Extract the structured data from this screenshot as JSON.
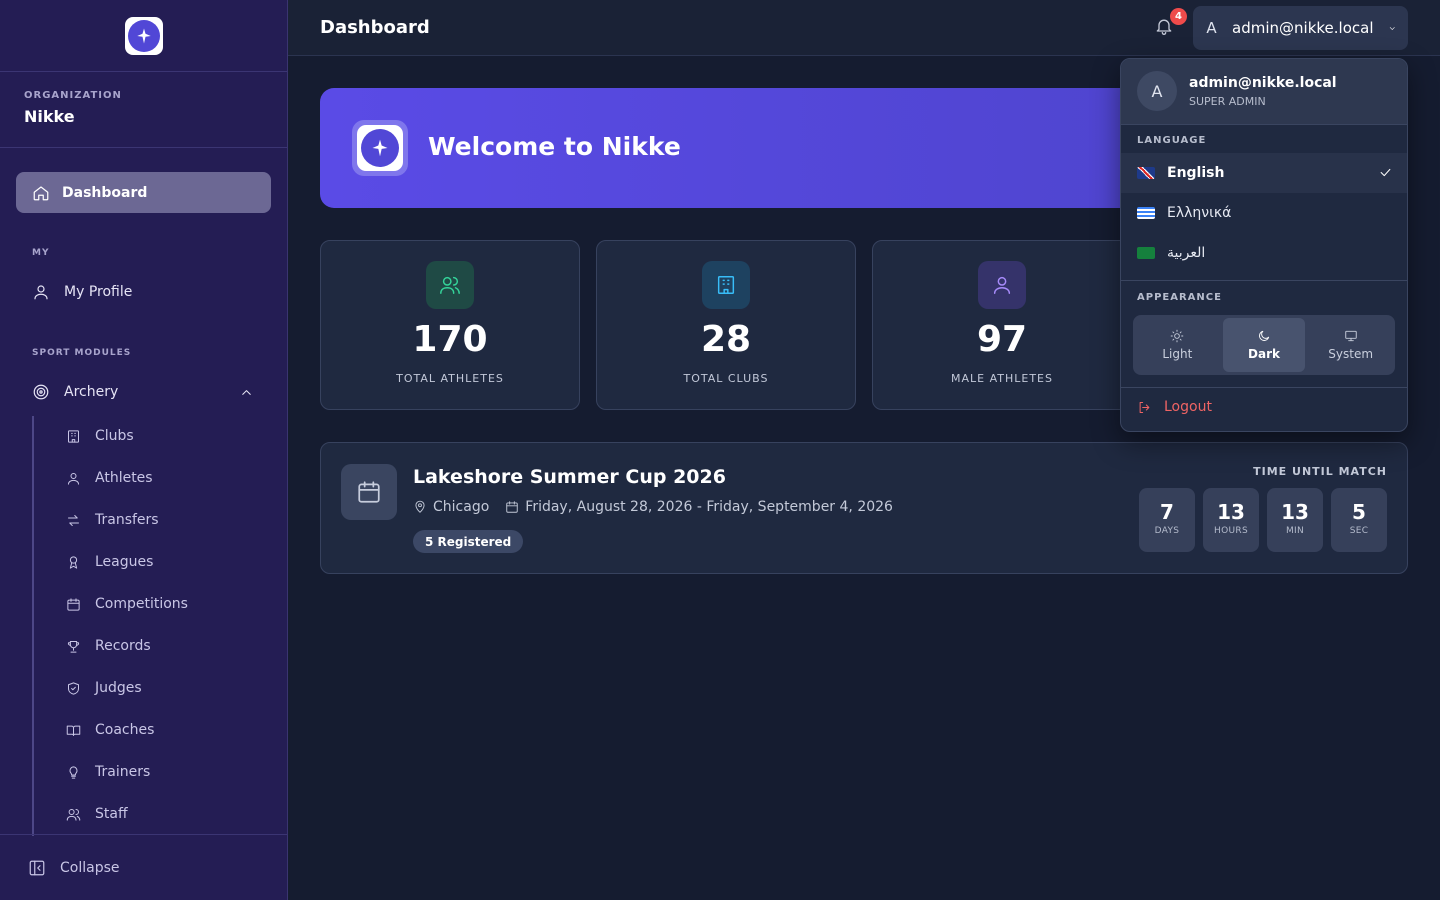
{
  "sidebar": {
    "org_label": "ORGANIZATION",
    "org_name": "Nikke",
    "active_item": "Dashboard",
    "section_my": "MY",
    "my_profile": "My Profile",
    "section_sport": "SPORT MODULES",
    "sport": "Archery",
    "sub_items": [
      {
        "label": "Clubs",
        "icon": "building-icon"
      },
      {
        "label": "Athletes",
        "icon": "user-icon"
      },
      {
        "label": "Transfers",
        "icon": "transfer-icon"
      },
      {
        "label": "Leagues",
        "icon": "award-icon"
      },
      {
        "label": "Competitions",
        "icon": "calendar-icon"
      },
      {
        "label": "Records",
        "icon": "trophy-icon"
      },
      {
        "label": "Judges",
        "icon": "shield-icon"
      },
      {
        "label": "Coaches",
        "icon": "book-icon"
      },
      {
        "label": "Trainers",
        "icon": "lightbulb-icon"
      },
      {
        "label": "Staff",
        "icon": "users-icon"
      }
    ],
    "collapse": "Collapse"
  },
  "header": {
    "title": "Dashboard",
    "notifications": "4",
    "user_initial": "A",
    "user_email": "admin@nikke.local"
  },
  "banner": {
    "title": "Welcome to Nikke"
  },
  "stats": [
    {
      "value": "170",
      "label": "TOTAL ATHLETES",
      "color": "#34d399"
    },
    {
      "value": "28",
      "label": "TOTAL CLUBS",
      "color": "#38bdf8"
    },
    {
      "value": "97",
      "label": "MALE ATHLETES",
      "color": "#a78bfa"
    }
  ],
  "event": {
    "title": "Lakeshore Summer Cup 2026",
    "location": "Chicago",
    "dates": "Friday, August 28, 2026 - Friday, September 4, 2026",
    "registered": "5 Registered",
    "countdown_label": "TIME UNTIL MATCH",
    "countdown": [
      {
        "value": "7",
        "unit": "DAYS"
      },
      {
        "value": "13",
        "unit": "HOURS"
      },
      {
        "value": "13",
        "unit": "MIN"
      },
      {
        "value": "5",
        "unit": "SEC"
      }
    ]
  },
  "dropdown": {
    "initial": "A",
    "email": "admin@nikke.local",
    "role": "SUPER ADMIN",
    "language_label": "LANGUAGE",
    "languages": [
      "English",
      "Ελληνικά",
      "العربية"
    ],
    "selected_language": "English",
    "appearance_label": "APPEARANCE",
    "appearance": [
      "Light",
      "Dark",
      "System"
    ],
    "selected_appearance": "Dark",
    "logout": "Logout"
  },
  "colors": {
    "sidebar_bg": "#241d54",
    "accent": "#5a4be6",
    "danger": "#ef6464"
  }
}
